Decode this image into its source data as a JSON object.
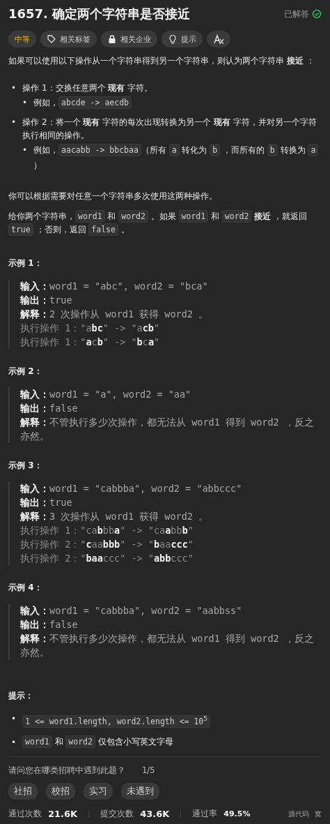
{
  "title": "1657. 确定两个字符串是否接近",
  "status": {
    "label": "已解答",
    "solved": true
  },
  "tags": [
    {
      "kind": "difficulty",
      "label": "中等"
    },
    {
      "kind": "topics",
      "label": "相关标签"
    },
    {
      "kind": "companies",
      "label": "相关企业"
    },
    {
      "kind": "hint",
      "label": "提示"
    },
    {
      "kind": "translate"
    }
  ],
  "intro": [
    {
      "kind": "text",
      "text": "如果可以使用以下操作从一个字符串得到另一个字符串，则认为两个字符串 **接近** ："
    }
  ],
  "operations": [
    {
      "bullet": "•",
      "text": [
        {
          "kind": "text",
          "text": "操作 1：交换任意两个 **现有** 字符。"
        }
      ],
      "sub_bullet": "•",
      "example": [
        {
          "kind": "text",
          "text": "例如，"
        },
        {
          "kind": "code",
          "text": "abcde -> aecdb"
        }
      ]
    },
    {
      "bullet": "•",
      "sub_bullet": "•",
      "text": [
        {
          "kind": "text",
          "text": "操作 2：将一个 **现有** 字符的每次出现转换为另一个 **现有** 字符，并对另一个字符执行相同的操作。"
        }
      ],
      "example": [
        {
          "kind": "text",
          "text": "例如，"
        },
        {
          "kind": "code",
          "text": "aacabb -> bbcbaa"
        },
        {
          "kind": "text",
          "text": "（所有 "
        },
        {
          "kind": "code",
          "text": "a"
        },
        {
          "kind": "text",
          "text": " 转化为 "
        },
        {
          "kind": "code",
          "text": "b"
        },
        {
          "kind": "text",
          "text": " ，而所有的 "
        },
        {
          "kind": "code",
          "text": "b"
        },
        {
          "kind": "text",
          "text": " 转换为 "
        },
        {
          "kind": "code",
          "text": "a"
        },
        {
          "kind": "text",
          "text": " ）"
        }
      ]
    }
  ],
  "notes": [
    [
      {
        "kind": "text",
        "text": "你可以根据需要对任意一个字符串多次使用这两种操作。"
      }
    ],
    [
      {
        "kind": "text",
        "text": "给你两个字符串，"
      },
      {
        "kind": "code",
        "text": "word1"
      },
      {
        "kind": "text",
        "text": " 和 "
      },
      {
        "kind": "code",
        "text": "word2"
      },
      {
        "kind": "text",
        "text": " 。如果 "
      },
      {
        "kind": "code",
        "text": "word1"
      },
      {
        "kind": "text",
        "text": " 和 "
      },
      {
        "kind": "code",
        "text": "word2"
      },
      {
        "kind": "text",
        "text": " **接近** ，就返回 "
      },
      {
        "kind": "code",
        "text": "true"
      },
      {
        "kind": "text",
        "text": " ；否则，返回 "
      },
      {
        "kind": "code",
        "text": "false"
      },
      {
        "kind": "text",
        "text": " 。"
      }
    ]
  ],
  "examples": [
    {
      "heading": "示例 1：",
      "lines": [
        {
          "kind": "io",
          "text": "**输入：**word1 = \"abc\", word2 = \"bca\""
        },
        {
          "kind": "io",
          "text": "**输出：**true"
        },
        {
          "kind": "io",
          "text": "**解释：**2 次操作从 word1 获得 word2 。"
        },
        {
          "kind": "step",
          "text": "执行操作 1：\"a**bc**\" -> \"a**cb**\""
        },
        {
          "kind": "step",
          "text": "执行操作 1：\"**a**c**b**\" -> \"**b**c**a**\""
        }
      ]
    },
    {
      "heading": "示例 2：",
      "lines": [
        {
          "kind": "io",
          "text": "**输入：**word1 = \"a\", word2 = \"aa\""
        },
        {
          "kind": "io",
          "text": "**输出：**false"
        },
        {
          "kind": "io",
          "text": "**解释：**不管执行多少次操作，都无法从 word1 得到 word2 ，反之亦然。"
        }
      ]
    },
    {
      "heading": "示例 3：",
      "lines": [
        {
          "kind": "io",
          "text": "**输入：**word1 = \"cabbba\", word2 = \"abbccc\""
        },
        {
          "kind": "io",
          "text": "**输出：**true"
        },
        {
          "kind": "io",
          "text": "**解释：**3 次操作从 word1 获得 word2 。"
        },
        {
          "kind": "step",
          "text": "执行操作 1：\"ca**b**bb**a**\" -> \"ca**a**bb**b**\""
        },
        {
          "kind": "step",
          "text": "执行操作 2：\"**c**aa**bbb**\" -> \"**b**aa**ccc**\""
        },
        {
          "kind": "step",
          "text": "执行操作 2：\"**baa**ccc\" -> \"**abb**ccc\""
        }
      ]
    },
    {
      "heading": "示例 4：",
      "lines": [
        {
          "kind": "io",
          "text": "**输入：**word1 = \"cabbba\", word2 = \"aabbss\""
        },
        {
          "kind": "io",
          "text": "**输出：**false"
        },
        {
          "kind": "io",
          "text": "**解释：**不管执行多少次操作，都无法从 word1 得到 word2 ，反之亦然。"
        }
      ]
    }
  ],
  "constraints_heading": "提示：",
  "constraints": [
    {
      "bullet": "•",
      "text": [
        {
          "kind": "code",
          "text": "1 <= word1.length, word2.length <= 10$^{5}$"
        }
      ]
    },
    {
      "bullet": "•",
      "text": [
        {
          "kind": "code",
          "text": "word1"
        },
        {
          "kind": "text",
          "text": " 和 "
        },
        {
          "kind": "code",
          "text": "word2"
        },
        {
          "kind": "text",
          "text": " 仅包含小写英文字母"
        }
      ]
    }
  ],
  "survey": {
    "question": "请问您在哪类招聘中遇到此题？",
    "progress": "1/5",
    "options": [
      "社招",
      "校招",
      "实习",
      "未遇到"
    ]
  },
  "stats": [
    {
      "label": "通过次数",
      "value": "21.6K"
    },
    {
      "label": "提交次数",
      "value": "43.6K"
    },
    {
      "label": "通过率",
      "value": "49.5%"
    }
  ],
  "footer": [
    "源代码",
    "窝"
  ]
}
